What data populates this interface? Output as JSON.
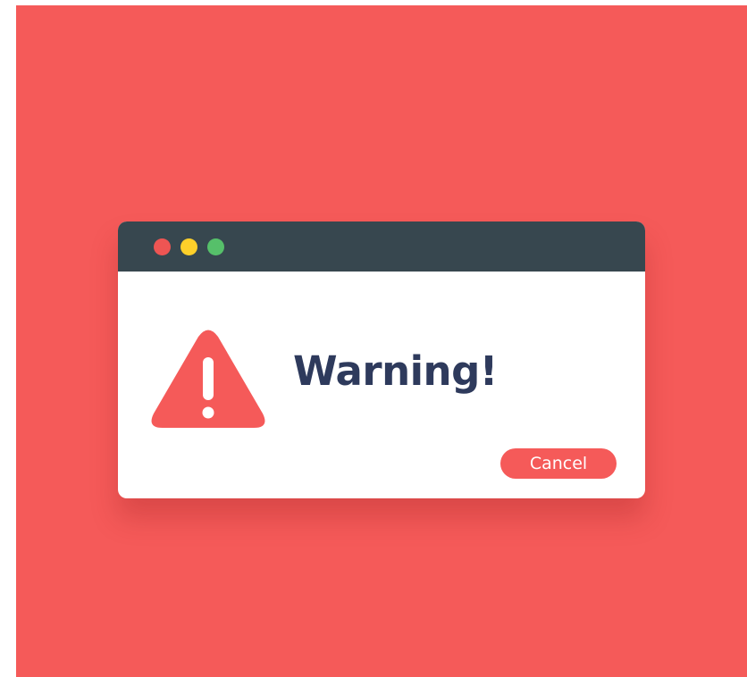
{
  "colors": {
    "background": "#f55a59",
    "titlebar": "#37474f",
    "dialog": "#ffffff",
    "accent": "#f55a59",
    "text": "#2e3a5c"
  },
  "window_controls": [
    {
      "name": "close",
      "color": "#ee5553"
    },
    {
      "name": "minimize",
      "color": "#fdd02a"
    },
    {
      "name": "maximize",
      "color": "#56c06a"
    }
  ],
  "dialog": {
    "icon": "warning-triangle-icon",
    "title": "Warning!",
    "cancel_label": "Cancel"
  }
}
